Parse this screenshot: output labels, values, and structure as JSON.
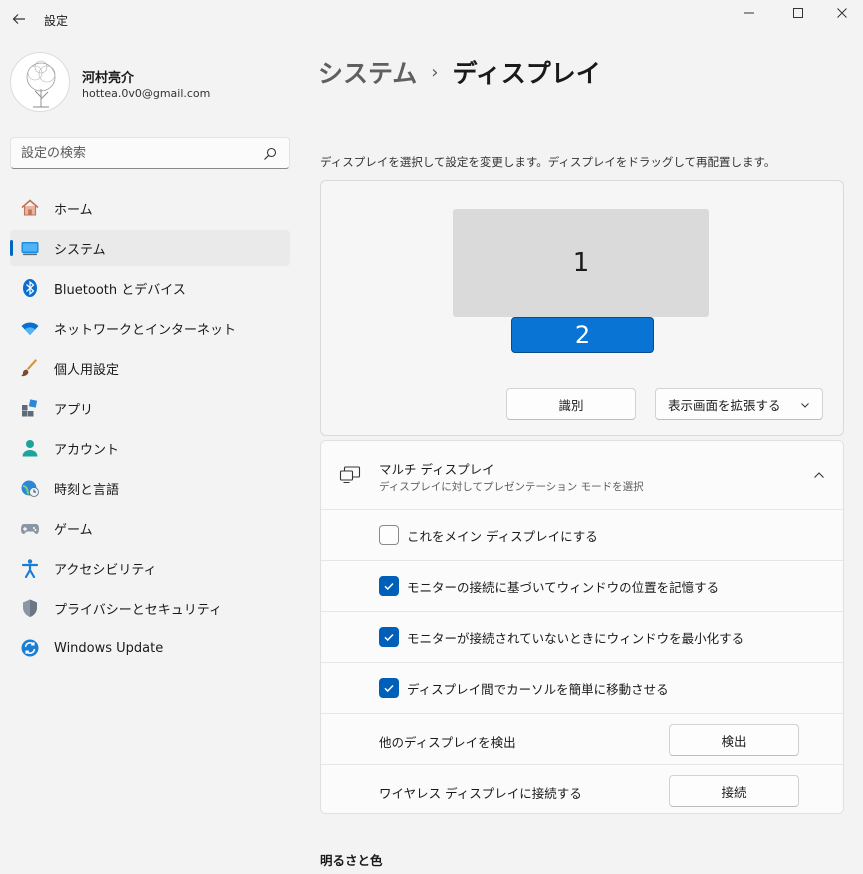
{
  "window": {
    "title": "設定"
  },
  "profile": {
    "name": "河村亮介",
    "email": "hottea.0v0@gmail.com"
  },
  "search": {
    "placeholder": "設定の検索"
  },
  "sidebar": {
    "items": [
      {
        "label": "ホーム",
        "icon": "home-icon"
      },
      {
        "label": "システム",
        "icon": "system-display-icon",
        "selected": true
      },
      {
        "label": "Bluetooth とデバイス",
        "icon": "bluetooth-icon"
      },
      {
        "label": "ネットワークとインターネット",
        "icon": "wifi-icon"
      },
      {
        "label": "個人用設定",
        "icon": "brush-icon"
      },
      {
        "label": "アプリ",
        "icon": "apps-icon"
      },
      {
        "label": "アカウント",
        "icon": "account-icon"
      },
      {
        "label": "時刻と言語",
        "icon": "globe-clock-icon"
      },
      {
        "label": "ゲーム",
        "icon": "gamepad-icon"
      },
      {
        "label": "アクセシビリティ",
        "icon": "accessibility-icon"
      },
      {
        "label": "プライバシーとセキュリティ",
        "icon": "shield-icon"
      },
      {
        "label": "Windows Update",
        "icon": "update-icon"
      }
    ]
  },
  "breadcrumb": {
    "parent": "システム",
    "separator": "›",
    "current": "ディスプレイ"
  },
  "display": {
    "instruction": "ディスプレイを選択して設定を変更します。ディスプレイをドラッグして再配置します。",
    "monitor1_label": "1",
    "monitor2_label": "2",
    "selected_monitor": "2",
    "identify_label": "識別",
    "mode_label": "表示画面を拡張する"
  },
  "multi_display": {
    "title": "マルチ ディスプレイ",
    "subtitle": "ディスプレイに対してプレゼンテーション モードを選択",
    "options": [
      {
        "label": "これをメイン ディスプレイにする",
        "checked": false
      },
      {
        "label": "モニターの接続に基づいてウィンドウの位置を記憶する",
        "checked": true
      },
      {
        "label": "モニターが接続されていないときにウィンドウを最小化する",
        "checked": true
      },
      {
        "label": "ディスプレイ間でカーソルを簡単に移動させる",
        "checked": true
      }
    ],
    "detect": {
      "label": "他のディスプレイを検出",
      "button": "検出"
    },
    "connect": {
      "label": "ワイヤレス ディスプレイに接続する",
      "button": "接続"
    }
  },
  "brightness": {
    "heading": "明るさと色"
  },
  "colors": {
    "accent": "#0067c0",
    "selected_monitor": "#0a74d4",
    "checkbox_on": "#005fb8",
    "background": "#f3f3f3"
  }
}
